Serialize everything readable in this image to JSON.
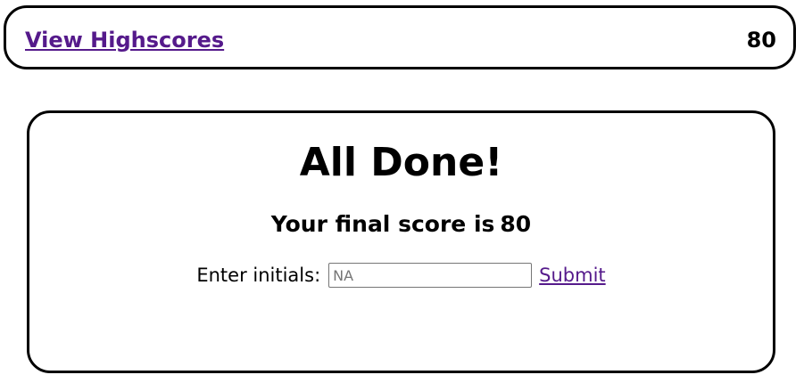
{
  "header": {
    "highscores_link": "View Highscores",
    "score": "80"
  },
  "result": {
    "title": "All Done!",
    "final_score_label": "Your final score is",
    "final_score_value": "80",
    "initials_label": "Enter initials:",
    "initials_placeholder": "NA",
    "initials_value": "",
    "submit_label": "Submit"
  },
  "colors": {
    "link": "#551a8b",
    "border": "#000000",
    "background": "#ffffff"
  }
}
